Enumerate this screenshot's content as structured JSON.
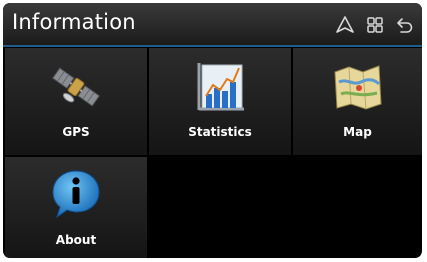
{
  "header": {
    "title": "Information",
    "icons": [
      "navigation-icon",
      "grid-menu-icon",
      "back-icon"
    ]
  },
  "tiles": [
    {
      "label": "GPS",
      "icon": "satellite-icon"
    },
    {
      "label": "Statistics",
      "icon": "statistics-chart-icon"
    },
    {
      "label": "Map",
      "icon": "map-icon"
    },
    {
      "label": "About",
      "icon": "info-bubble-icon"
    }
  ],
  "colors": {
    "background": "#000000",
    "header_divider": "#1e5f8c",
    "tile": "#222222",
    "text": "#ffffff"
  }
}
